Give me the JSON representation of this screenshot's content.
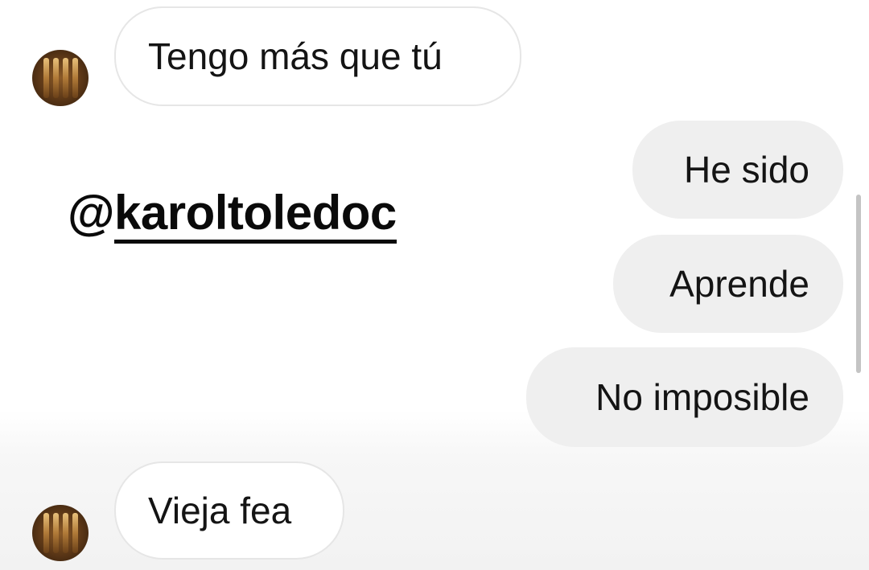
{
  "messages": [
    {
      "direction": "incoming",
      "text": "Tengo más que tú",
      "show_avatar": true
    },
    {
      "direction": "outgoing",
      "text": "He sido"
    },
    {
      "direction": "outgoing",
      "text": "Aprende"
    },
    {
      "direction": "outgoing",
      "text": "No imposible"
    },
    {
      "direction": "incoming",
      "text": "Vieja fea",
      "show_avatar": true
    }
  ],
  "sticker": {
    "at": "@",
    "handle": "karoltoledoc"
  },
  "colors": {
    "background": "#ffffff",
    "incoming_bubble": "#ffffff",
    "incoming_border": "#e6e6e6",
    "outgoing_bubble": "#efefef",
    "text": "#141414"
  },
  "icons": {
    "avatar": "contact-avatar-icon"
  }
}
